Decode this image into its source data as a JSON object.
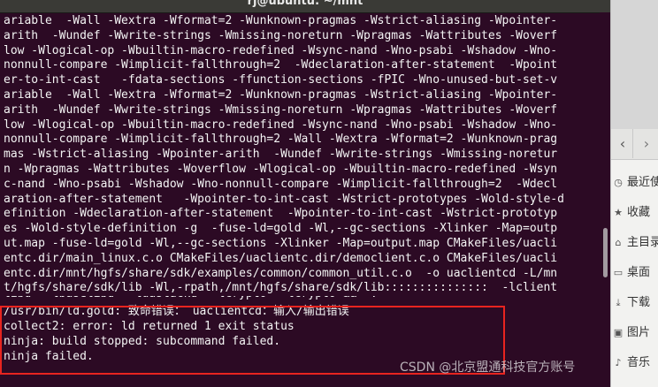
{
  "window": {
    "title": "rj@ubuntu: ~/mnt"
  },
  "terminal_lines": [
    "ariable  -Wall -Wextra -Wformat=2 -Wunknown-pragmas -Wstrict-aliasing -Wpointer-",
    "arith  -Wundef -Wwrite-strings -Wmissing-noreturn -Wpragmas -Wattributes -Woverf",
    "low -Wlogical-op -Wbuiltin-macro-redefined -Wsync-nand -Wno-psabi -Wshadow -Wno-",
    "nonnull-compare -Wimplicit-fallthrough=2  -Wdeclaration-after-statement  -Wpoint",
    "er-to-int-cast   -fdata-sections -ffunction-sections -fPIC -Wno-unused-but-set-v",
    "ariable  -Wall -Wextra -Wformat=2 -Wunknown-pragmas -Wstrict-aliasing -Wpointer-",
    "arith  -Wundef -Wwrite-strings -Wmissing-noreturn -Wpragmas -Wattributes -Woverf",
    "low -Wlogical-op -Wbuiltin-macro-redefined -Wsync-nand -Wno-psabi -Wshadow -Wno-",
    "nonnull-compare -Wimplicit-fallthrough=2 -Wall -Wextra -Wformat=2 -Wunknown-prag",
    "mas -Wstrict-aliasing -Wpointer-arith  -Wundef -Wwrite-strings -Wmissing-noretur",
    "n -Wpragmas -Wattributes -Woverflow -Wlogical-op -Wbuiltin-macro-redefined -Wsyn",
    "c-nand -Wno-psabi -Wshadow -Wno-nonnull-compare -Wimplicit-fallthrough=2  -Wdecl",
    "aration-after-statement   -Wpointer-to-int-cast -Wstrict-prototypes -Wold-style-d",
    "efinition -Wdeclaration-after-statement  -Wpointer-to-int-cast -Wstrict-prototyp",
    "es -Wold-style-definition -g  -fuse-ld=gold -Wl,--gc-sections -Xlinker -Map=outp",
    "ut.map -fuse-ld=gold -Wl,--gc-sections -Xlinker -Map=output.map CMakeFiles/uacli",
    "entc.dir/main_linux.c.o CMakeFiles/uaclientc.dir/democlient.c.o CMakeFiles/uacli",
    "entc.dir/mnt/hgfs/share/sdk/examples/common/common_util.c.o  -o uaclientcd -L/mn",
    "t/hgfs/share/sdk/lib -Wl,-rpath,/mnt/hgfs/share/sdk/lib:::::::::::::::  -lclient"
  ],
  "partial_line": "libd  -lbaselibd  -luastackd  -lcrypto  -lcrypto &&  :",
  "error_lines": [
    "/usr/bin/ld.gold: 致命错误： uaclientcd：输入/输出错误",
    "collect2: error: ld returned 1 exit status",
    "ninja: build stopped: subcommand failed.",
    "ninja failed."
  ],
  "file_manager": {
    "items": [
      {
        "label": "最近使",
        "icon": "clock-icon"
      },
      {
        "label": "收藏",
        "icon": "star-icon"
      },
      {
        "label": "主目录",
        "icon": "home-icon"
      },
      {
        "label": "桌面",
        "icon": "folder-icon"
      },
      {
        "label": "下载",
        "icon": "download-icon"
      },
      {
        "label": "图片",
        "icon": "image-icon"
      },
      {
        "label": "音乐",
        "icon": "music-icon"
      }
    ]
  },
  "watermark": "CSDN @北京盟通科技官方账号",
  "colors": {
    "terminal_bg": "#2c0a24",
    "terminal_fg": "#f4f4f4",
    "highlight": "#e8241f"
  }
}
